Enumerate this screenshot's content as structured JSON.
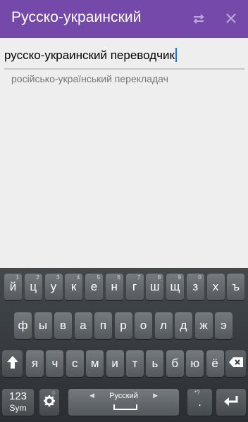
{
  "app": {
    "title": "Русско-украинский",
    "colors": {
      "appbar": "#7549a9",
      "background": "#eeeeee",
      "caret": "#1a73e8"
    },
    "icons": {
      "swap": "swap-arrows-icon",
      "close": "close-icon"
    }
  },
  "input": {
    "value": "русско-украинский переводчик"
  },
  "result": {
    "translation": "російсько-український перекладач"
  },
  "keyboard": {
    "row1": [
      {
        "label": "й",
        "hint": "1"
      },
      {
        "label": "ц",
        "hint": "2"
      },
      {
        "label": "у",
        "hint": "3"
      },
      {
        "label": "к",
        "hint": "4"
      },
      {
        "label": "е",
        "hint": "5"
      },
      {
        "label": "н",
        "hint": "6"
      },
      {
        "label": "г",
        "hint": "7"
      },
      {
        "label": "ш",
        "hint": "8"
      },
      {
        "label": "щ",
        "hint": "9"
      },
      {
        "label": "з",
        "hint": "0"
      },
      {
        "label": "х",
        "hint": ""
      },
      {
        "label": "ъ",
        "hint": ""
      }
    ],
    "row2": [
      "ф",
      "ы",
      "в",
      "а",
      "п",
      "р",
      "о",
      "л",
      "д",
      "ж",
      "э"
    ],
    "row3": [
      "я",
      "ч",
      "с",
      "м",
      "и",
      "т",
      "ь",
      "б",
      "ю",
      "ё"
    ],
    "sym_top": "123",
    "sym_bottom": "Sym",
    "language": "Русский",
    "period": ".",
    "period_hint": "*?",
    "settings_hint": "☺",
    "icons": {
      "shift": "shift-arrow-icon",
      "backspace": "backspace-icon",
      "settings": "gear-icon",
      "enter": "enter-icon"
    }
  }
}
